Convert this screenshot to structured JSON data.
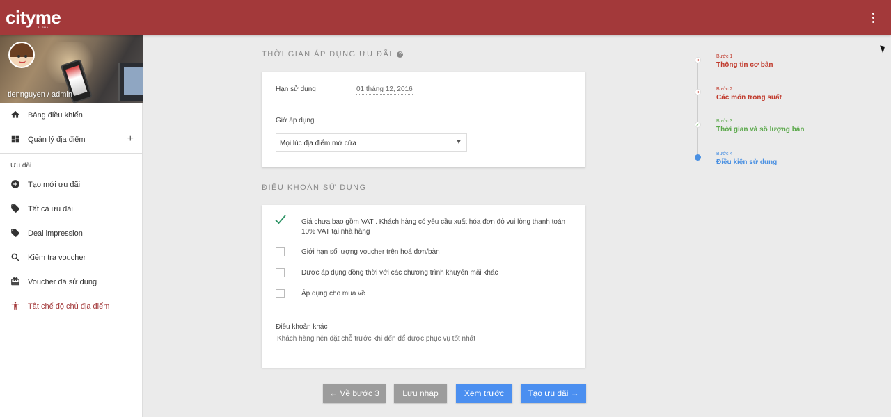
{
  "app": {
    "logo": "cityme",
    "logo_sub": "ALPHA"
  },
  "colors": {
    "brand": "#a3393a",
    "primary_button": "#4b8ff0",
    "secondary_button": "#9c9c9c",
    "step_done": "#c0392b",
    "step_current": "#5aa84a",
    "step_next": "#4a90e2"
  },
  "sidebar": {
    "user": "tiennguyen / admin",
    "top_items": [
      {
        "label": "Bảng điều khiển",
        "icon": "home-icon"
      },
      {
        "label": "Quản lý địa điểm",
        "icon": "dashboard-icon"
      }
    ],
    "section_label": "Ưu đãi",
    "items": [
      {
        "label": "Tạo mới ưu đãi",
        "icon": "add-circle-icon"
      },
      {
        "label": "Tất cả ưu đãi",
        "icon": "tag-icon"
      },
      {
        "label": "Deal impression",
        "icon": "tag-icon"
      },
      {
        "label": "Kiểm tra voucher",
        "icon": "search-icon"
      },
      {
        "label": "Voucher đã sử dụng",
        "icon": "redeem-icon"
      },
      {
        "label": "Tắt chế độ chủ địa điểm",
        "icon": "accessibility-icon"
      }
    ]
  },
  "time_section": {
    "title": "THỜI GIAN ÁP DỤNG ƯU ĐÃI",
    "expiry_label": "Hạn sử dụng",
    "expiry_value": "01 tháng 12, 2016",
    "hours_label": "Giờ áp dụng",
    "hours_value": "Mọi lúc địa điểm mở cửa"
  },
  "terms_section": {
    "title": "ĐIỀU KHOẢN SỬ DỤNG",
    "terms": [
      {
        "text": "Giá chưa bao gồm VAT . Khách hàng có yêu cầu xuất hóa đơn đỏ vui lòng thanh toán 10% VAT tại nhà hàng",
        "checked": true
      },
      {
        "text": "Giới hạn số lượng voucher trên hoá đơn/bàn",
        "checked": false
      },
      {
        "text": "Được áp dụng đồng thời với các chương trình khuyến mãi khác",
        "checked": false
      },
      {
        "text": "Áp dụng cho mua về",
        "checked": false
      }
    ],
    "other_title": "Điều khoản khác",
    "other_text": "Khách hàng nên đặt chỗ trước khi đến để được phục vụ tốt nhất"
  },
  "buttons": {
    "back": "← Về bước 3",
    "draft": "Lưu nháp",
    "preview": "Xem trước",
    "create": "Tạo ưu đãi →"
  },
  "steps": [
    {
      "small": "Bước 1",
      "title": "Thông tin cơ bản",
      "status": "done"
    },
    {
      "small": "Bước 2",
      "title": "Các món trong suất",
      "status": "done"
    },
    {
      "small": "Bước 3",
      "title": "Thời gian và số lượng bán",
      "status": "checked"
    },
    {
      "small": "Bước 4",
      "title": "Điều kiện sử dụng",
      "status": "current"
    }
  ]
}
